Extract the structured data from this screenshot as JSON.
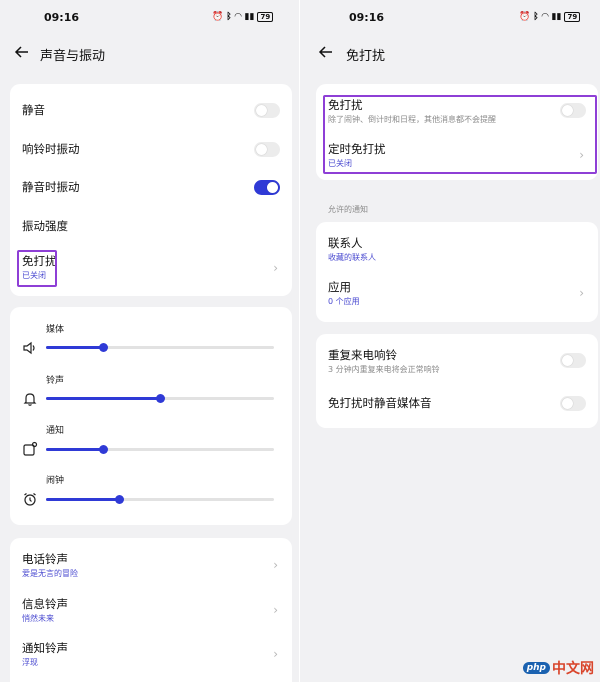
{
  "left": {
    "status": {
      "time": "09:16",
      "battery": "79"
    },
    "header": {
      "title": "声音与振动"
    },
    "card1": {
      "items": [
        {
          "label": "静音",
          "toggle": false
        },
        {
          "label": "响铃时振动",
          "toggle": false
        },
        {
          "label": "静音时振动",
          "toggle": true
        },
        {
          "label": "振动强度"
        },
        {
          "label": "免打扰",
          "sub": "已关闭"
        }
      ]
    },
    "volume": {
      "items": [
        {
          "label": "媒体",
          "icon": "speaker-icon",
          "level": 0.25
        },
        {
          "label": "铃声",
          "icon": "bell-icon",
          "level": 0.5
        },
        {
          "label": "通知",
          "icon": "notification-icon",
          "level": 0.25
        },
        {
          "label": "闹钟",
          "icon": "alarm-clock-icon",
          "level": 0.32
        }
      ]
    },
    "ringtones": {
      "items": [
        {
          "label": "电话铃声",
          "sub": "爱是无言的冒险"
        },
        {
          "label": "信息铃声",
          "sub": "悄然未来"
        },
        {
          "label": "通知铃声",
          "sub": "浮现"
        }
      ]
    }
  },
  "right": {
    "status": {
      "time": "09:16",
      "battery": "79"
    },
    "header": {
      "title": "免打扰"
    },
    "card1": {
      "dnd_label": "免打扰",
      "dnd_desc": "除了闹钟、倒计时和日程，其他消息都不会提醒",
      "dnd_toggle": false,
      "schedule_label": "定时免打扰",
      "schedule_sub": "已关闭"
    },
    "allowed_caption": "允许的通知",
    "card2": {
      "contacts_label": "联系人",
      "contacts_sub": "收藏的联系人",
      "apps_label": "应用",
      "apps_sub": "0 个应用"
    },
    "card3": {
      "repeat_label": "重复来电响铃",
      "repeat_desc": "3 分钟内重复来电将会正常响铃",
      "repeat_toggle": false,
      "mute_media_label": "免打扰时静音媒体音",
      "mute_media_toggle": false
    }
  },
  "watermark": {
    "badge": "php",
    "text": "中文网"
  },
  "colors": {
    "accent": "#2f3ad6",
    "highlight": "#8e3fd6",
    "background": "#f1f1f3"
  }
}
